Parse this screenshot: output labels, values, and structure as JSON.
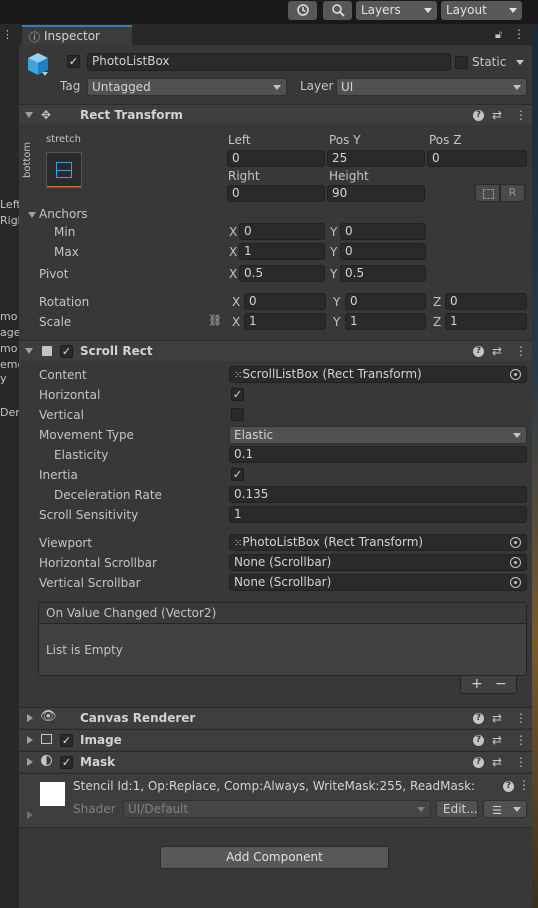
{
  "toolbar": {
    "history_icon": "history-icon",
    "search_icon": "search-icon",
    "layers": "Layers",
    "layout": "Layout"
  },
  "left_panel": {
    "texts": [
      "Left",
      "Righ",
      "mo",
      "age",
      "mo",
      "eme",
      "y",
      "Den"
    ]
  },
  "tab": {
    "title": "Inspector"
  },
  "object": {
    "name": "PhotoListBox",
    "static_label": "Static",
    "tag_label": "Tag",
    "tag_value": "Untagged",
    "layer_label": "Layer",
    "layer_value": "UI"
  },
  "rect_transform": {
    "title": "Rect Transform",
    "anchor_preset_label": "stretch",
    "anchor_preset_side": "bottom",
    "left_label": "Left",
    "left_value": "0",
    "posy_label": "Pos Y",
    "posy_value": "25",
    "posz_label": "Pos Z",
    "posz_value": "0",
    "right_label": "Right",
    "right_value": "0",
    "height_label": "Height",
    "height_value": "90",
    "r_button": "R",
    "anchors_label": "Anchors",
    "min_label": "Min",
    "min_x": "0",
    "min_y": "0",
    "max_label": "Max",
    "max_x": "1",
    "max_y": "0",
    "pivot_label": "Pivot",
    "pivot_x": "0.5",
    "pivot_y": "0.5",
    "rotation_label": "Rotation",
    "rot_x": "0",
    "rot_y": "0",
    "rot_z": "0",
    "scale_label": "Scale",
    "scale_x": "1",
    "scale_y": "1",
    "scale_z": "1",
    "x": "X",
    "y": "Y",
    "z": "Z"
  },
  "scroll_rect": {
    "title": "Scroll Rect",
    "content_label": "Content",
    "content_value": "ScrollListBox (Rect Transform)",
    "horizontal_label": "Horizontal",
    "vertical_label": "Vertical",
    "movement_label": "Movement Type",
    "movement_value": "Elastic",
    "elasticity_label": "Elasticity",
    "elasticity_value": "0.1",
    "inertia_label": "Inertia",
    "decel_label": "Deceleration Rate",
    "decel_value": "0.135",
    "sensitivity_label": "Scroll Sensitivity",
    "sensitivity_value": "1",
    "viewport_label": "Viewport",
    "viewport_value": "PhotoListBox (Rect Transform)",
    "hscroll_label": "Horizontal Scrollbar",
    "hscroll_value": "None (Scrollbar)",
    "vscroll_label": "Vertical Scrollbar",
    "vscroll_value": "None (Scrollbar)",
    "event_title": "On Value Changed (Vector2)",
    "event_empty": "List is Empty",
    "plus": "+",
    "minus": "−"
  },
  "canvas_renderer": {
    "title": "Canvas Renderer"
  },
  "image": {
    "title": "Image"
  },
  "mask": {
    "title": "Mask"
  },
  "material": {
    "info": "Stencil Id:1, Op:Replace, Comp:Always, WriteMask:255, ReadMask:",
    "shader_label": "Shader",
    "shader_value": "UI/Default",
    "edit_button": "Edit..."
  },
  "add_component": "Add Component",
  "colors": {
    "accent": "#3a79bb",
    "panel": "#383838",
    "header": "#3e3e3e",
    "field": "#2a2a2a"
  }
}
